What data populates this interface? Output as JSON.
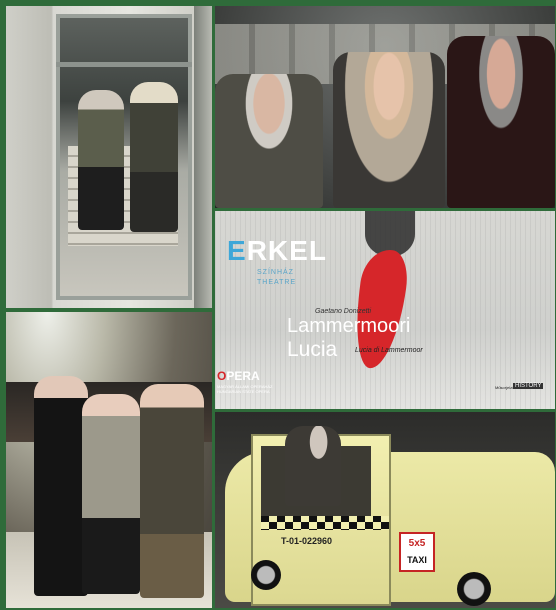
{
  "collage": {
    "photos": [
      {
        "subject": "two women standing behind glass door"
      },
      {
        "subject": "three women seated in theatre"
      },
      {
        "subject": "opera poster"
      },
      {
        "subject": "three women in theatre lobby"
      },
      {
        "subject": "woman entering yellow taxi"
      }
    ]
  },
  "poster": {
    "logo_letters": "R",
    "logo_first": "E",
    "logo_rest": "KEL",
    "venue_line1": "SZÍNHÁZ",
    "venue_line2": "THEATRE",
    "composer": "Gaetano Donizetti",
    "title_line1": "Lammermoori",
    "title_line2": "Lucia",
    "subtitle": "Lucia di Lammermoor",
    "opera_o": "O",
    "opera_rest": "PERA",
    "opera_sub": "MAGYAR ÁLLAMI OPERAHÁZ HUNGARIAN STATE OPERA",
    "sponsor_label": "Műsorjelző",
    "sponsor_logo": "HISTORY"
  },
  "taxi": {
    "plate": "T-01-022960",
    "sign_number": "5x5",
    "sign_word": "TAXI"
  },
  "colors": {
    "border": "#2f6b3a",
    "poster_red": "#d6262a",
    "logo_blue": "#3ea7d8",
    "taxi_yellow": "#ece9a7"
  }
}
